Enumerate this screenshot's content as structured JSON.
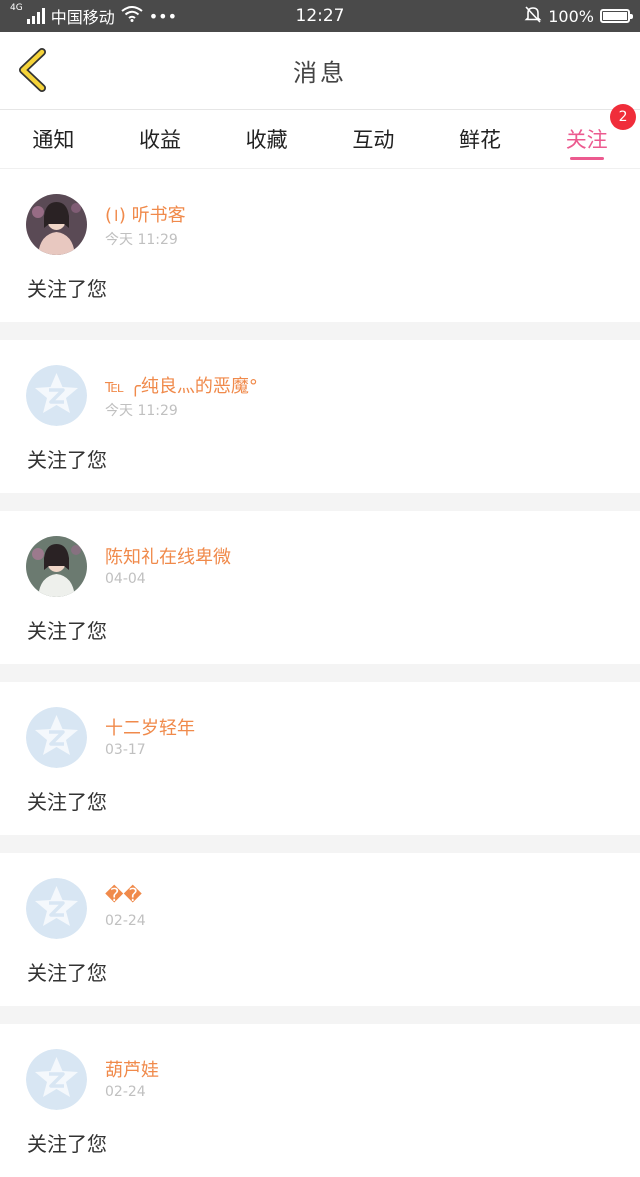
{
  "status_bar": {
    "network": "4G",
    "carrier": "中国移动",
    "dots": "•••",
    "time": "12:27",
    "battery": "100%",
    "battery_level": 1.0
  },
  "header": {
    "title": "消息"
  },
  "tabs": [
    {
      "label": "通知"
    },
    {
      "label": "收益"
    },
    {
      "label": "收藏"
    },
    {
      "label": "互动"
    },
    {
      "label": "鲜花"
    },
    {
      "label": "关注",
      "badge": "2",
      "active": true
    }
  ],
  "messages": [
    {
      "name": "(।) 听书客",
      "time": "今天 11:29",
      "text": "关注了您",
      "avatar": "photo-girl-icon"
    },
    {
      "name": "℡ ╭纯良灬的恶魔°",
      "time": "今天 11:29",
      "text": "关注了您",
      "avatar": "default-avatar-icon"
    },
    {
      "name": "陈知礼在线卑微",
      "time": "04-04",
      "text": "关注了您",
      "avatar": "photo-girl-icon"
    },
    {
      "name": "十二岁轻年",
      "time": "03-17",
      "text": "关注了您",
      "avatar": "default-avatar-icon"
    },
    {
      "name": "��",
      "time": "02-24",
      "text": "关注了您",
      "avatar": "default-avatar-icon"
    },
    {
      "name": "葫芦娃",
      "time": "02-24",
      "text": "关注了您",
      "avatar": "default-avatar-icon"
    }
  ],
  "colors": {
    "accent": "#ec5a8f",
    "name": "#f08a4b",
    "badge": "#f02d3a",
    "back_arrow": "#f5d33a"
  }
}
